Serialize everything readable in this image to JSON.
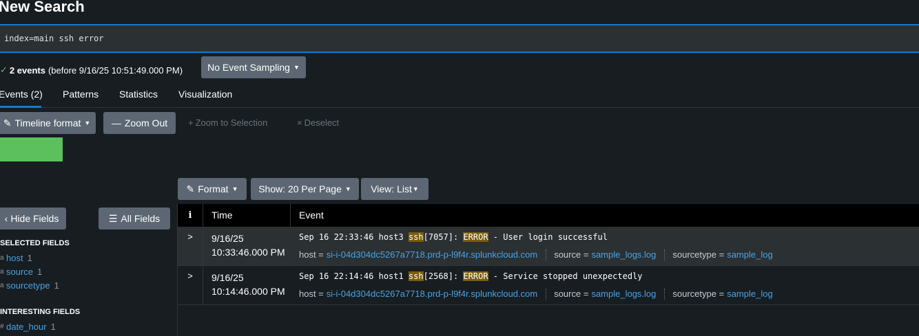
{
  "page": {
    "title": "New Search"
  },
  "search": {
    "query": "index=main ssh error"
  },
  "status": {
    "check": "✓",
    "events_label": "2 events",
    "before_text": "(before 9/16/25 10:51:49.000 PM)"
  },
  "sampling": {
    "label": "No Event Sampling"
  },
  "tabs": [
    {
      "label": "Events (2)",
      "active": true
    },
    {
      "label": "Patterns"
    },
    {
      "label": "Statistics"
    },
    {
      "label": "Visualization"
    }
  ],
  "timeline": {
    "format_label": "Timeline format",
    "zoom_out_label": "Zoom Out",
    "zoom_selection_label": "Zoom to Selection",
    "deselect_label": "Deselect"
  },
  "results_toolbar": {
    "format_label": "Format",
    "show_label": "Show: 20 Per Page",
    "view_label": "View: List"
  },
  "sidebar": {
    "hide_fields_label": "Hide Fields",
    "all_fields_label": "All Fields",
    "selected_title": "SELECTED FIELDS",
    "selected_fields": [
      {
        "type": "a",
        "name": "host",
        "count": "1"
      },
      {
        "type": "a",
        "name": "source",
        "count": "1"
      },
      {
        "type": "a",
        "name": "sourcetype",
        "count": "1"
      }
    ],
    "interesting_title": "INTERESTING FIELDS",
    "interesting_fields": [
      {
        "type": "#",
        "name": "date_hour",
        "count": "1"
      }
    ]
  },
  "table": {
    "headers": {
      "info": "i",
      "time": "Time",
      "event": "Event"
    },
    "rows": [
      {
        "date": "9/16/25",
        "time": "10:33:46.000 PM",
        "raw_pre": "Sep 16 22:33:46 host3 ",
        "raw_hl1": "ssh",
        "raw_mid": "[7057]: ",
        "raw_hl2": "ERROR",
        "raw_post": " - User login successful",
        "host_key": "host =",
        "host": "si-i-04d304dc5267a7718.prd-p-l9f4r.splunkcloud.com",
        "source_key": "source =",
        "source": "sample_logs.log",
        "sourcetype_key": "sourcetype =",
        "sourcetype": "sample_log"
      },
      {
        "date": "9/16/25",
        "time": "10:14:46.000 PM",
        "raw_pre": "Sep 16 22:14:46 host1 ",
        "raw_hl1": "ssh",
        "raw_mid": "[2568]: ",
        "raw_hl2": "ERROR",
        "raw_post": " - Service stopped unexpectedly",
        "host_key": "host =",
        "host": "si-i-04d304dc5267a7718.prd-p-l9f4r.splunkcloud.com",
        "source_key": "source =",
        "source": "sample_logs.log",
        "sourcetype_key": "sourcetype =",
        "sourcetype": "sample_log"
      }
    ]
  },
  "colors": {
    "background": "#171d21",
    "accent": "#1a79c9",
    "button": "#5c6773",
    "link": "#4aa3e4",
    "timeline_bar": "#5cc05c",
    "highlight": "#7a5d0e"
  }
}
